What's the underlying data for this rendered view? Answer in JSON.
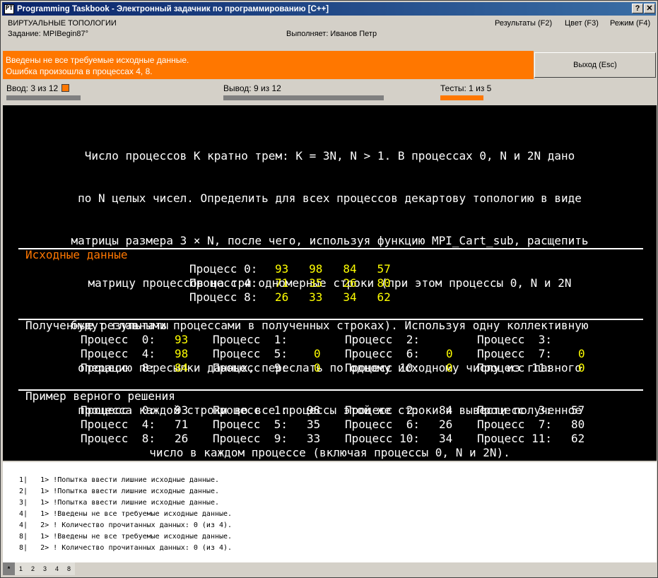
{
  "window": {
    "title": "Programming Taskbook - Электронный задачник по программированию [C++]",
    "icon_glyph": "PT",
    "help_glyph": "?",
    "close_glyph": "✕"
  },
  "header": {
    "topic": "ВИРТУАЛЬНЫЕ ТОПОЛОГИИ",
    "task": "Задание: MPIBegin87°",
    "performer": "Выполняет: Иванов Петр",
    "menu": {
      "results": "Результаты (F2)",
      "color": "Цвет (F3)",
      "mode": "Режим (F4)"
    }
  },
  "error": {
    "line1": "Введены не все требуемые исходные данные.",
    "line2": "Ошибка произошла в процессах 4, 8.",
    "exit_label": "Выход (Esc)"
  },
  "status": {
    "input": "Ввод: 3 из 12",
    "output": "Вывод: 9 из 12",
    "tests": "Тесты: 1 из 5",
    "input_progress": 0.25,
    "output_progress": 0.75,
    "tests_progress": 0.2,
    "colors": {
      "error": "#ff7700",
      "value": "#ffff00",
      "panel": "#000000"
    }
  },
  "task_text": [
    "Число процессов K кратно трем: K = 3N, N > 1. В процессах 0, N и 2N дано",
    "по N целых чисел. Определить для всех процессов декартову топологию в виде",
    "матрицы размера 3 × N, после чего, используя функцию MPI_Cart_sub, расщепить",
    "матрицу процессов на три одномерные строки (при этом процессы 0, N и 2N",
    "будут главными процессами в полученных строках). Используя одну коллективную",
    "операцию пересылки данных, переслать по одному исходному числу из главного",
    "процесса каждой строки во все процессы этой же строки и вывести полученное",
    "число в каждом процессе (включая процессы 0, N и 2N)."
  ],
  "input_data": {
    "title": "Исходные данные",
    "rows": [
      {
        "label": "Процесс 0:",
        "values": "93   98   84   57"
      },
      {
        "label": "Процесс 4:",
        "values": "71   35   26   80"
      },
      {
        "label": "Процесс 8:",
        "values": "26   33   34   62"
      }
    ]
  },
  "results": {
    "title": "Полученные результаты",
    "cells": [
      {
        "label": "Процесс  0:",
        "value": "93"
      },
      {
        "label": "Процесс  1:",
        "value": ""
      },
      {
        "label": "Процесс  2:",
        "value": ""
      },
      {
        "label": "Процесс  3:",
        "value": ""
      },
      {
        "label": "Процесс  4:",
        "value": "98"
      },
      {
        "label": "Процесс  5:",
        "value": "0"
      },
      {
        "label": "Процесс  6:",
        "value": "0"
      },
      {
        "label": "Процесс  7:",
        "value": "0"
      },
      {
        "label": "Процесс  8:",
        "value": "84"
      },
      {
        "label": "Процесс  9:",
        "value": "0"
      },
      {
        "label": "Процесс 10:",
        "value": "0"
      },
      {
        "label": "Процесс 11:",
        "value": "0"
      }
    ]
  },
  "example": {
    "title": "Пример верного решения",
    "cells": [
      {
        "label": "Процесс  0:",
        "value": "93"
      },
      {
        "label": "Процесс  1:",
        "value": "98"
      },
      {
        "label": "Процесс  2:",
        "value": "84"
      },
      {
        "label": "Процесс  3:",
        "value": "57"
      },
      {
        "label": "Процесс  4:",
        "value": "71"
      },
      {
        "label": "Процесс  5:",
        "value": "35"
      },
      {
        "label": "Процесс  6:",
        "value": "26"
      },
      {
        "label": "Процесс  7:",
        "value": "80"
      },
      {
        "label": "Процесс  8:",
        "value": "26"
      },
      {
        "label": "Процесс  9:",
        "value": "33"
      },
      {
        "label": "Процесс 10:",
        "value": "34"
      },
      {
        "label": "Процесс 11:",
        "value": "62"
      }
    ]
  },
  "log": [
    " 1|   1> !Попытка ввести лишние исходные данные.",
    " 2|   1> !Попытка ввести лишние исходные данные.",
    " 3|   1> !Попытка ввести лишние исходные данные.",
    " 4|   1> !Введены не все требуемые исходные данные.",
    " 4|   2> ! Количество прочитанных данных: 0 (из 4).",
    " 8|   1> !Введены не все требуемые исходные данные.",
    " 8|   2> ! Количество прочитанных данных: 0 (из 4)."
  ],
  "tabs": [
    "*",
    "1",
    "2",
    "3",
    "4",
    "8"
  ]
}
